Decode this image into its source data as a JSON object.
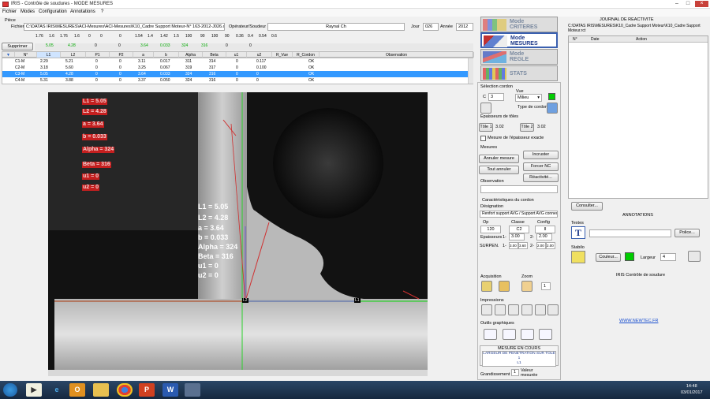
{
  "window": {
    "title": "IRIS - Contrôle de soudures - MODE MESURES"
  },
  "menu": [
    "Fichier",
    "Modes",
    "Configuration",
    "Annotations",
    "?"
  ],
  "piece": {
    "section_label": "Pièce",
    "fichier_label": "Fichier",
    "fichier_value": "C:\\DATAS IRIS\\MESURES\\ACI-Mesures\\ACI-Mesures\\K10_Cadre Support Moteur-N° 163-2012-J026.crd",
    "operateur_label": "Opérateur/Soudeur",
    "operateur_value": "Raynal Ch",
    "jour_label": "Jour",
    "jour_value": "026",
    "annee_label": "Année",
    "annee_value": "2012"
  },
  "limits_row": [
    "1.76",
    "1.6",
    "1.76",
    "1.6",
    "0",
    "0",
    "0",
    "1.54",
    "1.4",
    "1.42",
    "1.5",
    "100",
    "90",
    "100",
    "90",
    "0.36",
    "0.4",
    "0.54",
    "0.6"
  ],
  "summary": {
    "supprimer_label": "Supprimer",
    "values": [
      "5.05",
      "4.28",
      "0",
      "0",
      "3.64",
      "0.033",
      "324",
      "316",
      "0",
      "0"
    ]
  },
  "table": {
    "headers": [
      "N°",
      "L1",
      "L2",
      "P1",
      "P2",
      "a",
      "b",
      "Alpha",
      "Beta",
      "u1",
      "u2",
      "R_Vue",
      "R_Cordon",
      "Observation"
    ],
    "rows": [
      {
        "n": "C1-M",
        "L1": "2.29",
        "L2": "5.21",
        "P1": "0",
        "P2": "0",
        "a": "3.11",
        "b": "0.017",
        "alpha": "311",
        "beta": "314",
        "u1": "0",
        "u2": "0.117",
        "rc": "OK",
        "selected": false
      },
      {
        "n": "C2-M",
        "L1": "3.18",
        "L2": "5.60",
        "P1": "0",
        "P2": "0",
        "a": "3.25",
        "b": "0.067",
        "alpha": "319",
        "beta": "317",
        "u1": "0",
        "u2": "0.100",
        "rc": "OK",
        "selected": false
      },
      {
        "n": "C3-M",
        "L1": "5.05",
        "L2": "4.28",
        "P1": "0",
        "P2": "0",
        "a": "3.64",
        "b": "0.033",
        "alpha": "324",
        "beta": "316",
        "u1": "0",
        "u2": "0",
        "rc": "OK",
        "selected": true
      },
      {
        "n": "C4-M",
        "L1": "5.31",
        "L2": "3.88",
        "P1": "0",
        "P2": "0",
        "a": "3.37",
        "b": "0.050",
        "alpha": "324",
        "beta": "316",
        "u1": "0",
        "u2": "0",
        "rc": "OK",
        "selected": false
      }
    ]
  },
  "overlay_red": [
    "L1 = 5.05",
    "L2 = 4.28",
    "a = 3.64",
    "b = 0.033",
    "Alpha = 324",
    "Beta = 316",
    "u1 = 0",
    "u2 = 0"
  ],
  "overlay_white": [
    "L1 = 5.05",
    "L2 = 4.28",
    "a = 3.64",
    "b = 0.033",
    "Alpha = 324",
    "Beta = 316",
    "u1 = 0",
    "u2 = 0"
  ],
  "markers": {
    "l2": "L2",
    "l1": "L1"
  },
  "modes": [
    {
      "line1": "Mode",
      "line2": "CRITERES",
      "active": false
    },
    {
      "line1": "Mode",
      "line2": "MESURES",
      "active": true
    },
    {
      "line1": "Mode",
      "line2": "REGLE",
      "active": false
    },
    {
      "line1": "",
      "line2": "STATS",
      "active": false
    }
  ],
  "cordon": {
    "selection_label": "Sélection cordon",
    "c_label": "C",
    "c_value": "3",
    "vue_label": "Vue",
    "vue_value": "Milieu",
    "type_label": "Type de cordon",
    "epaisseurs_label": "Epaisseurs de tôles",
    "tole1_label": "Tôle 1",
    "tole1_value": "3.02",
    "tole2_label": "Tôle 2",
    "tole2_value": "3.02",
    "exact_label": "Mesure de l'épaisseur exacte"
  },
  "mesures": {
    "section_label": "Mesures",
    "annuler_mesure": "Annuler mesure",
    "incruster": "Incruster",
    "tout_annuler": "Tout annuler",
    "forcer_nc": "Forcer NC",
    "reactivite": "Réactivité...",
    "observation_label": "Observation"
  },
  "carac": {
    "section_label": "Caractéristiques du cordon",
    "designation_label": "Désignation",
    "designation_value": "Renfort support AVG / Support AVG connec",
    "op_label": "Op",
    "op_value": "120",
    "classe_label": "Classe",
    "classe_value": "C2",
    "config_label": "Config",
    "config_value": "II",
    "epaisseurs_label": "Epaisseurs",
    "ep1_label": "1-",
    "ep1_value": "3.00",
    "ep2_label": "2-",
    "ep2_value": "2.00",
    "surpen_label": "SURPEN.",
    "surpen_values": [
      "3.00",
      "3.60",
      "2.00",
      "2.00"
    ]
  },
  "tools": {
    "acquisition_label": "Acquisition",
    "zoom_label": "Zoom",
    "zoom_value": "1",
    "impressions_label": "Impressions",
    "outils_label": "Outils graphiques"
  },
  "mesure_en_cours": {
    "title": "MESURE EN COURS",
    "text": "LARGEUR DE PENETRATION SUR TOLE 1",
    "code": "L1"
  },
  "grandissement": {
    "label": "Grandissement",
    "value": "1",
    "value_label": "Valeur mesurée"
  },
  "journal": {
    "title": "JOURNAL DE REACTIVITE",
    "path": "C:\\DATAS IRIS\\MESURES\\K10_Cadre Support Moteur\\K10_Cadre Support Moteur.rct",
    "headers": [
      "N°",
      "Date",
      "Action"
    ],
    "consulter": "Consulter..."
  },
  "annotations": {
    "title": "ANNOTATIONS",
    "textes_label": "Textes",
    "police_button": "Police...",
    "stabilo_label": "Stabilo",
    "couleur_button": "Couleur...",
    "largeur_label": "Largeur",
    "largeur_value": "4"
  },
  "footer": {
    "app": "IRIS Contrôle de soudure",
    "url": "WWW.NEWTEC.FR"
  },
  "taskbar": {
    "time": "14:48",
    "date": "03/01/2017"
  },
  "colors": {
    "accent_green": "#00cc00",
    "overlay_red": "#c41f1f",
    "selection_blue": "#3399ff",
    "taskbar": "#1f3654"
  }
}
